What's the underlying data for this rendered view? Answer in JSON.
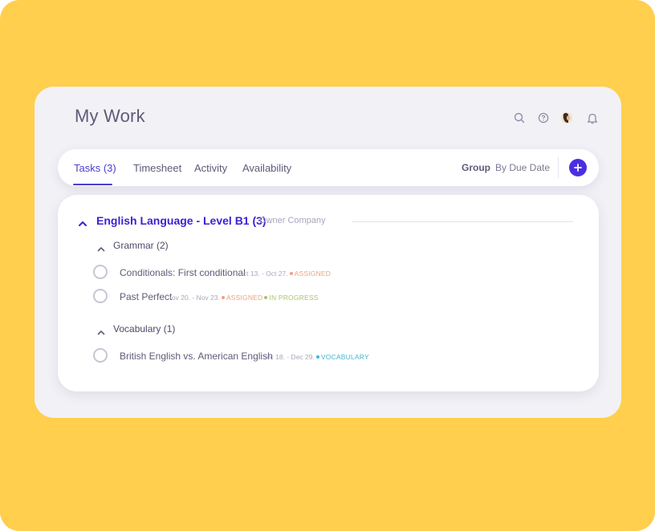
{
  "page": {
    "title": "My Work"
  },
  "header_icons": [
    "search-icon",
    "help-icon",
    "avatar",
    "bell-icon"
  ],
  "tabs": [
    {
      "label": "Tasks (3)",
      "active": true
    },
    {
      "label": "Timesheet",
      "active": false
    },
    {
      "label": "Activity",
      "active": false
    },
    {
      "label": "Availability",
      "active": false
    }
  ],
  "grouping": {
    "label": "Group",
    "value": "By Due Date"
  },
  "colors": {
    "accent": "#4A2FE0",
    "background": "#FFCF4D",
    "assigned": "#F2A07B",
    "in_progress": "#A6C46B",
    "vocabulary": "#3FB7D9"
  },
  "project": {
    "title": "English Language - Level B1 (3)",
    "owner": "Owner Company",
    "groups": [
      {
        "title": "Grammar (2)",
        "tasks": [
          {
            "name": "Conditionals: First conditional",
            "dates": "ct 13. - Oct 27.",
            "tags": [
              "ASSIGNED"
            ]
          },
          {
            "name": "Past Perfect",
            "dates": "ov 20. - Nov 23.",
            "tags": [
              "ASSIGNED",
              "IN PROGRESS"
            ]
          }
        ]
      },
      {
        "title": "Vocabulary (1)",
        "tasks": [
          {
            "name": "British English vs. American English",
            "dates": "ec 18. - Dec 29.",
            "tags": [
              "VOCABULARY"
            ]
          }
        ]
      }
    ]
  }
}
